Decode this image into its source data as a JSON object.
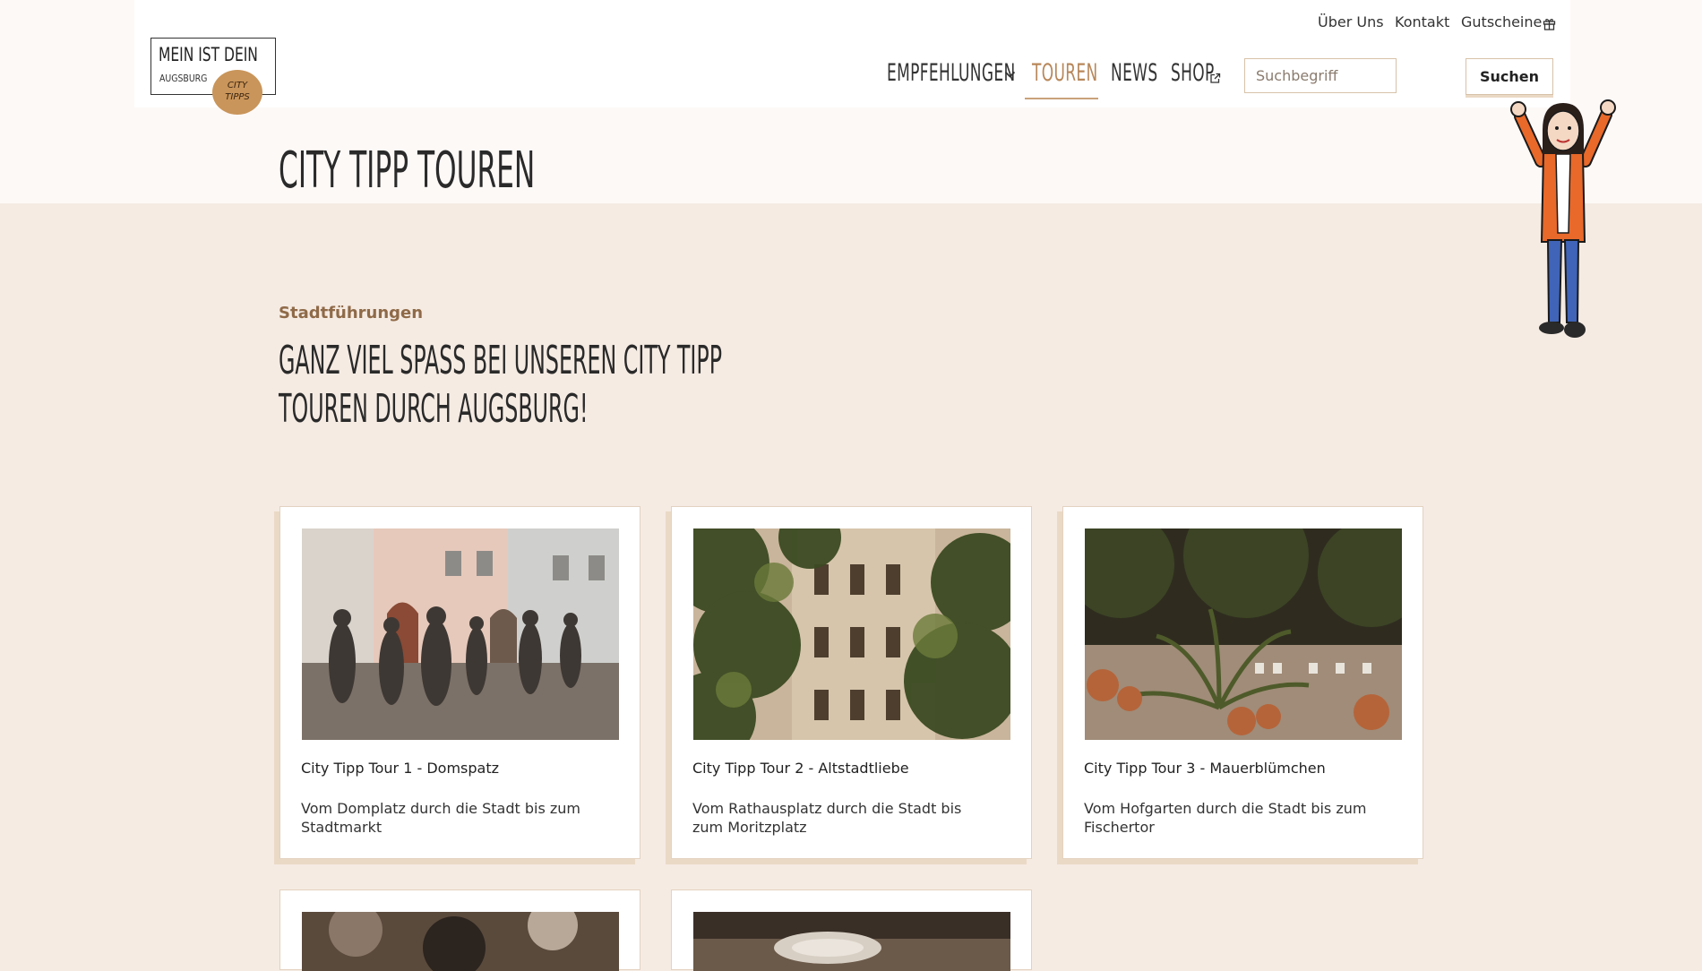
{
  "header": {
    "logo": {
      "line1": "MEIN IST DEIN",
      "line2": "AUGSBURG",
      "badge_line1": "CITY",
      "badge_line2": "TIPPS"
    },
    "meta_nav": [
      {
        "label": "Über Uns"
      },
      {
        "label": "Kontakt"
      },
      {
        "label": "Gutscheine",
        "icon": "gift-icon"
      }
    ],
    "main_nav": [
      {
        "label": "Empfehlungen",
        "icon": "chevron-down-icon"
      },
      {
        "label": "Touren",
        "active": true
      },
      {
        "label": "News"
      },
      {
        "label": "Shop",
        "icon": "external-link-icon"
      }
    ],
    "search": {
      "placeholder": "Suchbegriff",
      "value": "",
      "button_label": "Suchen"
    }
  },
  "main": {
    "page_title": "City Tipp Touren",
    "eyebrow": "Stadtführungen",
    "heading": "Ganz viel Spaß bei unseren City Tipp Touren durch Augsburg!",
    "cards": [
      {
        "title": "City Tipp Tour 1 - Domspatz",
        "description": "Vom Domplatz durch die Stadt bis zum Stadtmarkt"
      },
      {
        "title": "City Tipp Tour 2 - Altstadtliebe",
        "description": "Vom Rathausplatz durch die Stadt bis zum Moritzplatz"
      },
      {
        "title": "City Tipp Tour 3 - Mauerblümchen",
        "description": "Vom Hofgarten durch die Stadt bis zum Fischertor"
      }
    ]
  },
  "colors": {
    "accent": "#b8875a",
    "eyebrow": "#8f6a48",
    "page_background": "#f5ebe3",
    "logo_badge": "#c9955a"
  }
}
